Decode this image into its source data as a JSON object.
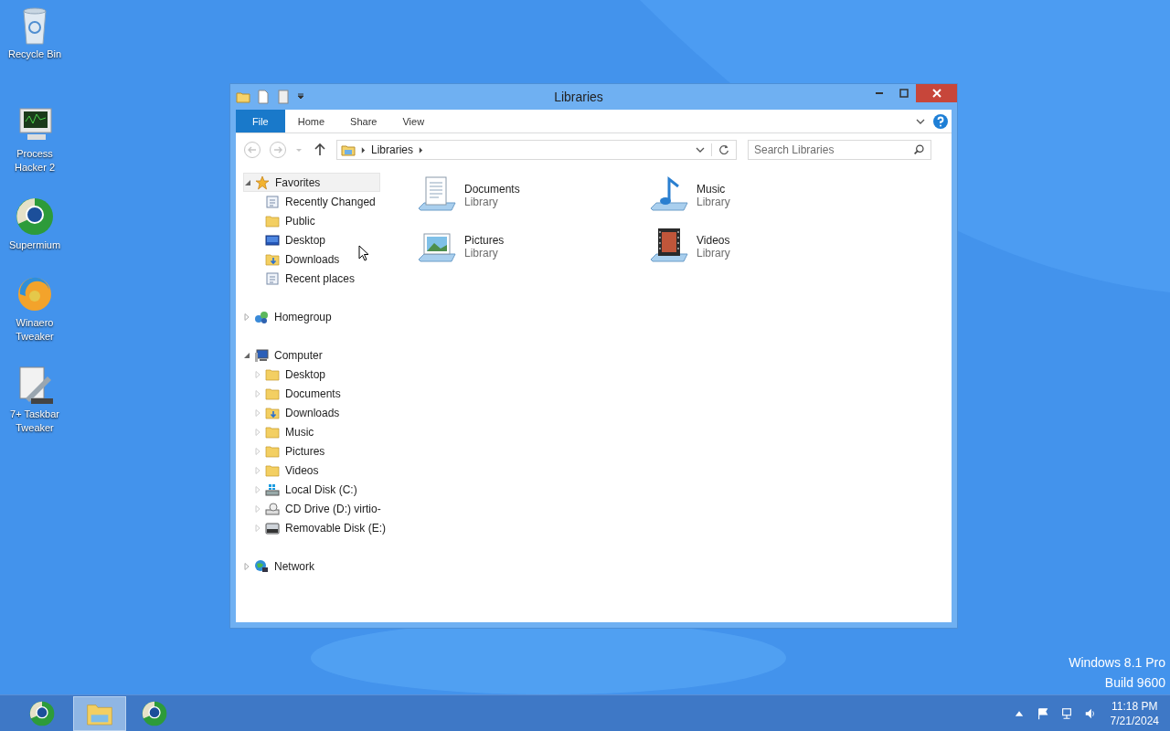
{
  "desktop_icons": [
    {
      "label": "Recycle Bin",
      "kind": "bin"
    },
    {
      "label": "Process Hacker 2",
      "kind": "monitor"
    },
    {
      "label": "Supermium",
      "kind": "browser"
    },
    {
      "label": "Winaero Tweaker",
      "kind": "swirl"
    },
    {
      "label": "7+ Taskbar Tweaker",
      "kind": "tools"
    }
  ],
  "window": {
    "title": "Libraries",
    "ribbon_tabs": [
      {
        "label": "File",
        "kind": "file",
        "selected": false
      },
      {
        "label": "Home",
        "kind": "tab",
        "selected": false
      },
      {
        "label": "Share",
        "kind": "tab",
        "selected": false
      },
      {
        "label": "View",
        "kind": "tab",
        "selected": false
      }
    ],
    "address": {
      "crumbs": [
        "Libraries"
      ]
    },
    "search": {
      "placeholder": "Search Libraries"
    },
    "nav_tree": [
      {
        "label": "Favorites",
        "kind": "star",
        "expanded": true,
        "selected": true,
        "children": [
          {
            "label": "Recently Changed",
            "kind": "recent"
          },
          {
            "label": "Public",
            "kind": "folder"
          },
          {
            "label": "Desktop",
            "kind": "desktop"
          },
          {
            "label": "Downloads",
            "kind": "downloads"
          },
          {
            "label": "Recent places",
            "kind": "recent"
          }
        ]
      },
      {
        "label": "Homegroup",
        "kind": "homegroup",
        "expanded": false,
        "selected": false
      },
      {
        "label": "Computer",
        "kind": "computer",
        "expanded": true,
        "selected": false,
        "children": [
          {
            "label": "Desktop",
            "kind": "folder",
            "expanded": false
          },
          {
            "label": "Documents",
            "kind": "folder",
            "expanded": false
          },
          {
            "label": "Downloads",
            "kind": "downloads",
            "expanded": false
          },
          {
            "label": "Music",
            "kind": "folder",
            "expanded": false
          },
          {
            "label": "Pictures",
            "kind": "folder",
            "expanded": false
          },
          {
            "label": "Videos",
            "kind": "folder",
            "expanded": false
          },
          {
            "label": "Local Disk (C:)",
            "kind": "disk",
            "expanded": false
          },
          {
            "label": "CD Drive (D:) virtio-",
            "kind": "cd",
            "expanded": false
          },
          {
            "label": "Removable Disk (E:)",
            "kind": "usb",
            "expanded": false
          }
        ]
      },
      {
        "label": "Network",
        "kind": "network",
        "expanded": false,
        "selected": false
      }
    ],
    "libraries": [
      {
        "name": "Documents",
        "type": "Library",
        "kind": "documents"
      },
      {
        "name": "Music",
        "type": "Library",
        "kind": "music"
      },
      {
        "name": "Pictures",
        "type": "Library",
        "kind": "pictures"
      },
      {
        "name": "Videos",
        "type": "Library",
        "kind": "videos"
      }
    ]
  },
  "os_edition": [
    "Windows 8.1 Pro",
    "Build 9600"
  ],
  "taskbar": {
    "buttons": [
      {
        "kind": "browser",
        "selected": false
      },
      {
        "kind": "explorer",
        "selected": true
      },
      {
        "kind": "browser",
        "selected": false
      }
    ],
    "clock": {
      "time": "11:18 PM",
      "date": "7/21/2024"
    }
  }
}
